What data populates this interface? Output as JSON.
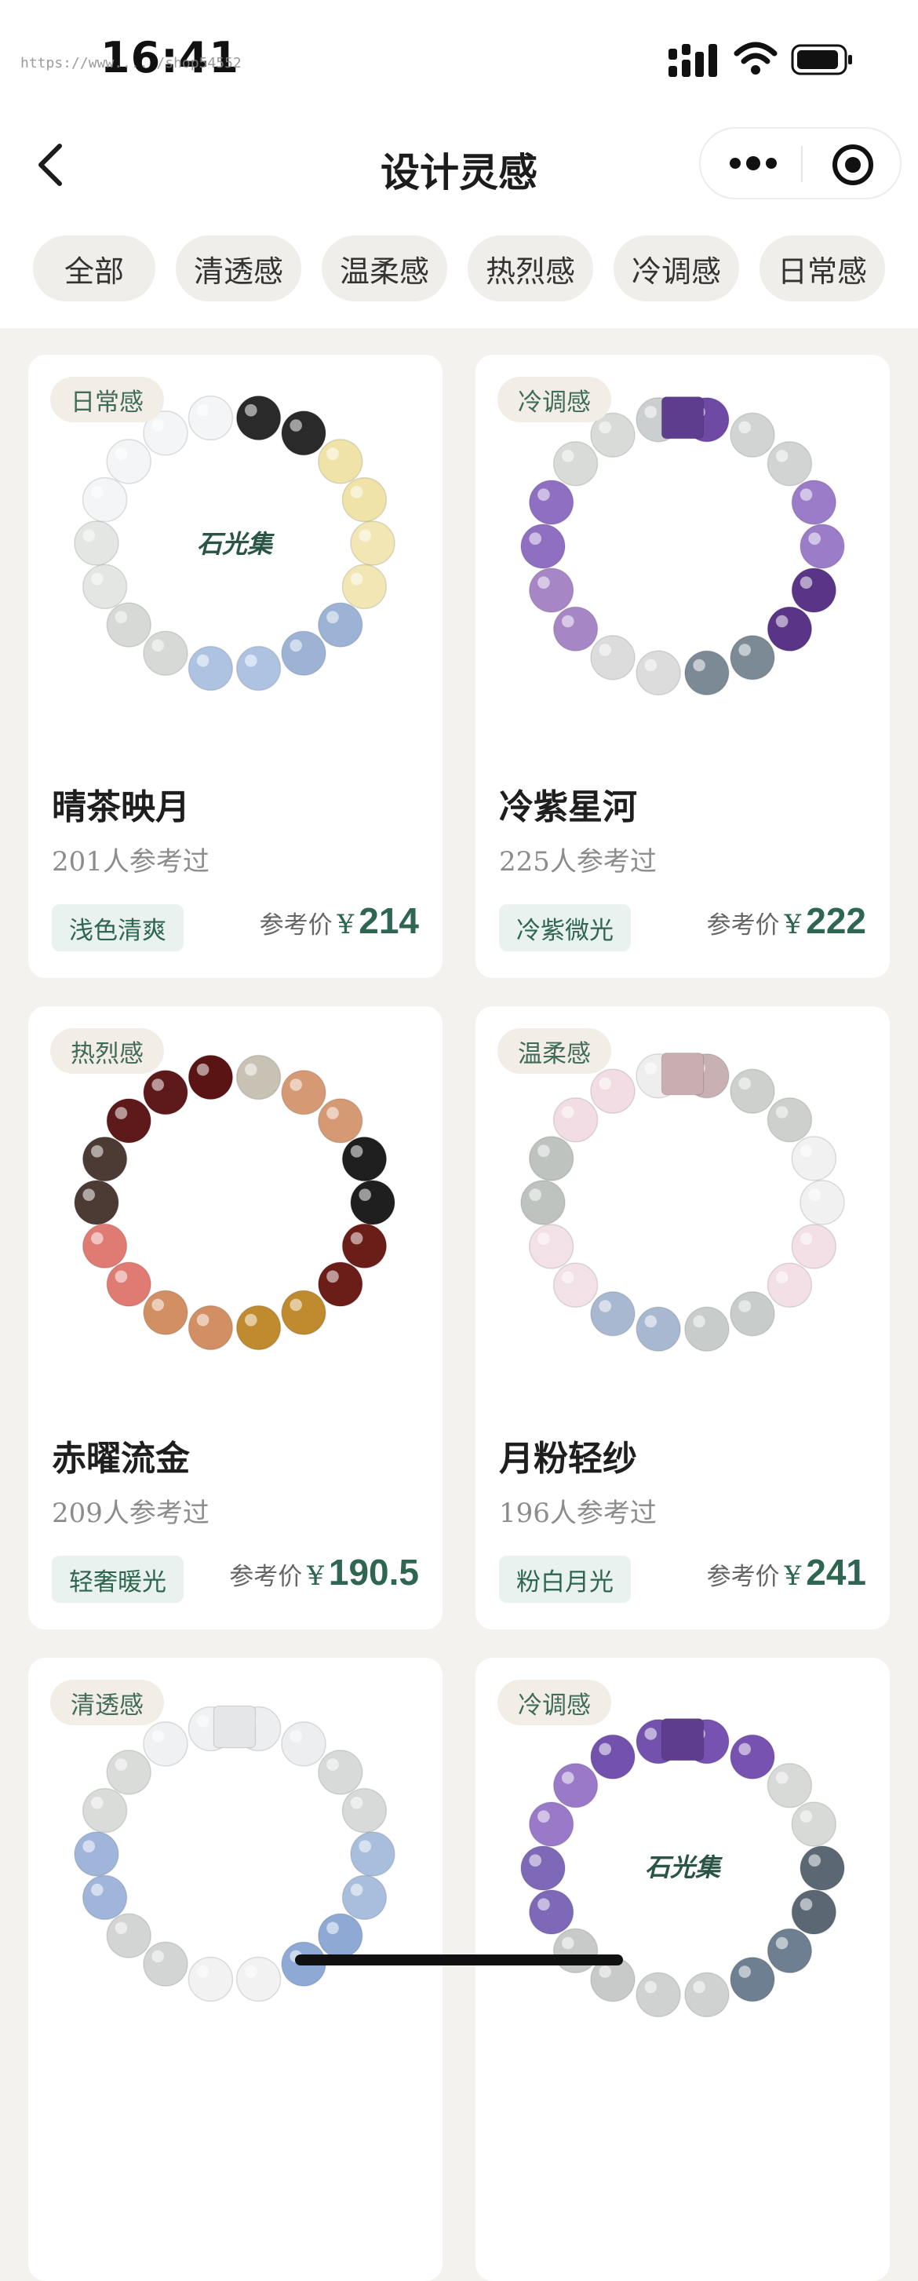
{
  "status_bar": {
    "time": "16:41",
    "watermark": "https://www.... /shop54552",
    "icons": [
      "cellular-signal-icon",
      "wifi-icon",
      "battery-icon"
    ]
  },
  "nav": {
    "title": "设计灵感",
    "icons": [
      "back-arrow-icon",
      "more-dots-icon",
      "target-circle-icon"
    ]
  },
  "filters": [
    {
      "label": "全部",
      "active": true
    },
    {
      "label": "清透感",
      "active": false
    },
    {
      "label": "温柔感",
      "active": false
    },
    {
      "label": "热烈感",
      "active": false
    },
    {
      "label": "冷调感",
      "active": false
    },
    {
      "label": "日常感",
      "active": false
    }
  ],
  "colors": {
    "accent": "#2e6b56",
    "price": "#2f6652",
    "chip_bg": "#efeeea",
    "page_bg": "#f4f2ee"
  },
  "products": [
    {
      "tag": "日常感",
      "name": "晴茶映月",
      "views": "201人参考过",
      "style": "浅色清爽",
      "price_label": "参考价",
      "currency": "¥",
      "price": "214",
      "logo": "石光集"
    },
    {
      "tag": "冷调感",
      "name": "冷紫星河",
      "views": "225人参考过",
      "style": "冷紫微光",
      "price_label": "参考价",
      "currency": "¥",
      "price": "222",
      "logo": ""
    },
    {
      "tag": "热烈感",
      "name": "赤曜流金",
      "views": "209人参考过",
      "style": "轻奢暖光",
      "price_label": "参考价",
      "currency": "¥",
      "price": "190.5",
      "logo": ""
    },
    {
      "tag": "温柔感",
      "name": "月粉轻纱",
      "views": "196人参考过",
      "style": "粉白月光",
      "price_label": "参考价",
      "currency": "¥",
      "price": "241",
      "logo": ""
    },
    {
      "tag": "清透感",
      "name": "",
      "views": "",
      "style": "",
      "price_label": "",
      "currency": "",
      "price": "",
      "logo": ""
    },
    {
      "tag": "冷调感",
      "name": "",
      "views": "",
      "style": "",
      "price_label": "",
      "currency": "",
      "price": "",
      "logo": "石光集"
    }
  ]
}
